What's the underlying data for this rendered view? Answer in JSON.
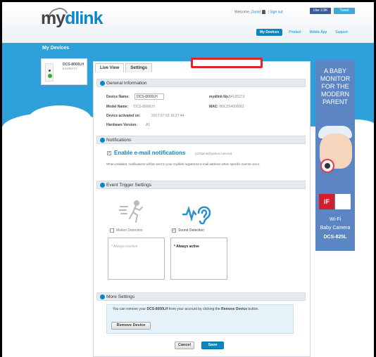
{
  "header": {
    "logo_prefix": "my",
    "logo_suffix": "dlink",
    "welcome": "Welcome, ",
    "username": "[June]",
    "separator": " | ",
    "sign_out": "Sign out",
    "like": "Like 2.8K",
    "tweet": "Tweet"
  },
  "nav": {
    "items": [
      "My Devices",
      "Product",
      "Mobile App",
      "Support"
    ]
  },
  "page": {
    "title": "My Devices"
  },
  "device": {
    "name": "DCS-8000LH",
    "number": "54195373"
  },
  "tabs": [
    "Live View",
    "Settings"
  ],
  "general": {
    "section_title": "General Information",
    "device_name_label": "Device Name:",
    "device_name_value": "DCS-8000LH",
    "mydlink_no_label": "mydlink No.:",
    "mydlink_no_value": "54195373",
    "model_name_label": "Model Name:",
    "model_name_value": "DCS-8000LH",
    "mac_label": "MAC:",
    "mac_value": "B0C554000001",
    "activated_label": "Device activated on:",
    "activated_value": "2017-07-03 16:27:44",
    "hw_label": "Hardware Version:",
    "hw_value": "A1"
  },
  "notifications": {
    "section_title": "Notifications",
    "enable_label": "Enable e-mail notifications",
    "email": "(ozstjune@yahoo.com.tw)",
    "description": "When enabled, notifications will be sent to your mydlink registered e-mail address when specific events occur."
  },
  "triggers": {
    "section_title": "Event Trigger Settings",
    "motion_label": "Motion Detection",
    "sound_label": "Sound Detection",
    "motion_schedule": "* Always inactive",
    "sound_schedule": "* Always active"
  },
  "more": {
    "section_title": "More Settings",
    "text_before": "You can remove your ",
    "text_device": "DCS-8000LH",
    "text_middle": " from your account by clicking the ",
    "text_action": "Remove Device",
    "text_after": " button.",
    "remove_button": "Remove Device"
  },
  "actions": {
    "cancel": "Cancel",
    "save": "Save"
  },
  "ad": {
    "headline": [
      "A BABY",
      "MONITOR",
      "FOR THE",
      "MODERN",
      "PARENT"
    ],
    "award": "iF",
    "line1": "Wi-Fi",
    "line2": "Baby Camera",
    "model": "DCS-825L"
  },
  "colors": {
    "brand_blue": "#0b86c5",
    "banner_blue": "#2ea0da",
    "highlight_red": "#e0242b"
  }
}
